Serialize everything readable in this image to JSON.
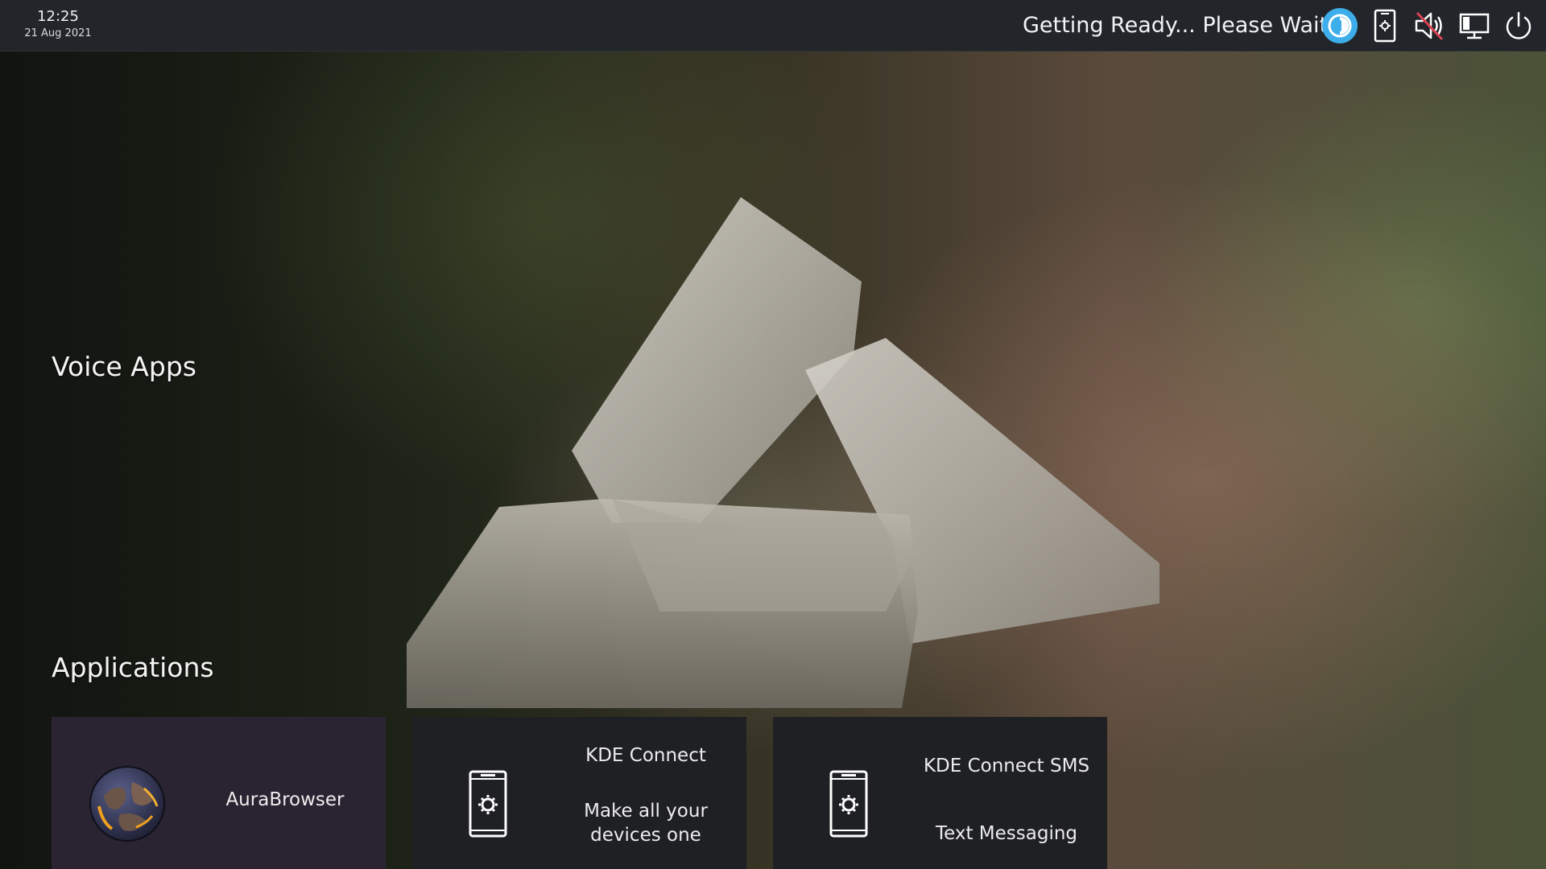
{
  "top_panel": {
    "clock": {
      "time": "12:25",
      "date": "21 Aug 2021"
    },
    "status_text": "Getting Ready... Please Wait",
    "tray_icons": [
      "mycroft-icon",
      "kde-connect-icon",
      "volume-muted-icon",
      "display-icon",
      "power-icon"
    ],
    "accent_color": "#3daee9"
  },
  "main": {
    "voice_apps_heading": "Voice Apps",
    "applications_heading": "Applications",
    "apps": [
      {
        "title": "AuraBrowser",
        "description": "",
        "icon": "globe-icon"
      },
      {
        "title": "KDE Connect",
        "description": "Make all your devices one",
        "icon": "phone-settings-icon"
      },
      {
        "title": "KDE Connect SMS",
        "description": "Text Messaging",
        "icon": "phone-settings-icon"
      }
    ]
  }
}
